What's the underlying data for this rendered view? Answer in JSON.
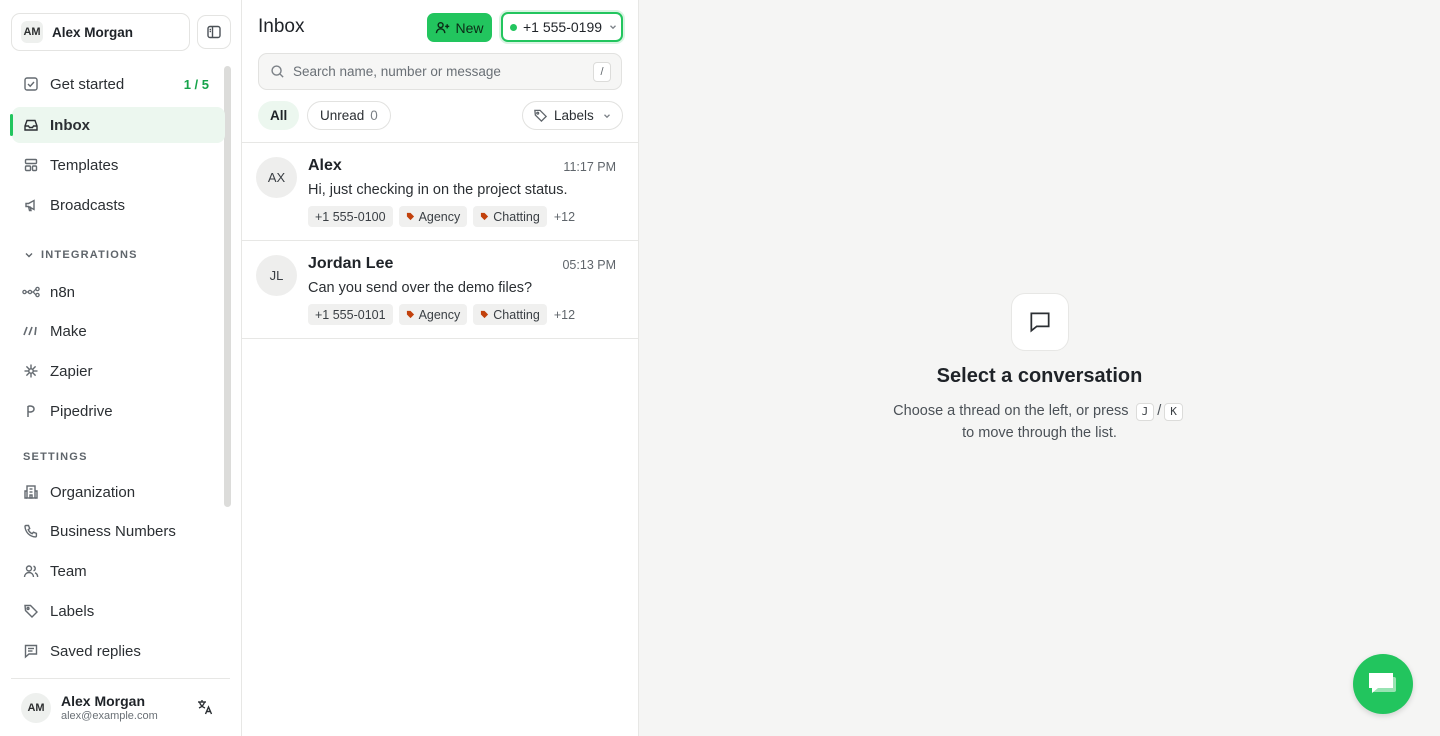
{
  "workspace": {
    "initials": "AM",
    "name": "Alex Morgan"
  },
  "nav": {
    "get_started": {
      "label": "Get started",
      "count": "1 / 5"
    },
    "inbox": "Inbox",
    "templates": "Templates",
    "broadcasts": "Broadcasts"
  },
  "integrations": {
    "heading": "INTEGRATIONS",
    "items": [
      "n8n",
      "Make",
      "Zapier",
      "Pipedrive"
    ]
  },
  "settings": {
    "heading": "SETTINGS",
    "items": [
      "Organization",
      "Business Numbers",
      "Team",
      "Labels",
      "Saved replies"
    ]
  },
  "user": {
    "initials": "AM",
    "name": "Alex Morgan",
    "email": "alex@example.com"
  },
  "list": {
    "title": "Inbox",
    "new_label": "New",
    "number": "+1 555-0199",
    "search_placeholder": "Search name, number or message",
    "search_shortcut": "/",
    "filters": {
      "all": "All",
      "unread": "Unread",
      "unread_count": "0",
      "labels": "Labels"
    }
  },
  "conversations": [
    {
      "initials": "AX",
      "name": "Alex",
      "time": "11:17 PM",
      "message": "Hi, just checking in on the project status.",
      "number": "+1 555-0100",
      "labels": [
        "Agency",
        "Chatting"
      ],
      "more": "+12"
    },
    {
      "initials": "JL",
      "name": "Jordan Lee",
      "time": "05:13 PM",
      "message": "Can you send over the demo files?",
      "number": "+1 555-0101",
      "labels": [
        "Agency",
        "Chatting"
      ],
      "more": "+12"
    }
  ],
  "empty_state": {
    "title": "Select a conversation",
    "line1": "Choose a thread on the left, or press",
    "key1": "J",
    "sep": "/",
    "key2": "K",
    "line2": "to move through the list."
  },
  "colors": {
    "accent": "#22c55e",
    "label_tag": "#c2410c"
  }
}
